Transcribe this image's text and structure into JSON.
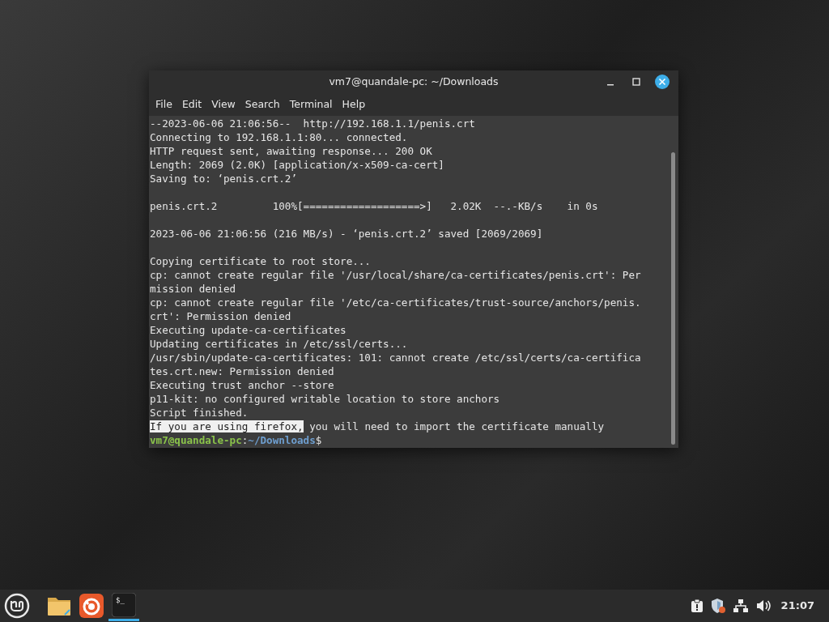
{
  "terminal": {
    "title": "vm7@quandale-pc: ~/Downloads",
    "menu": [
      "File",
      "Edit",
      "View",
      "Search",
      "Terminal",
      "Help"
    ],
    "lines": [
      {
        "kind": "text",
        "text": "--2023-06-06 21:06:56--  http://192.168.1.1/penis.crt"
      },
      {
        "kind": "text",
        "text": "Connecting to 192.168.1.1:80... connected."
      },
      {
        "kind": "text",
        "text": "HTTP request sent, awaiting response... 200 OK"
      },
      {
        "kind": "text",
        "text": "Length: 2069 (2.0K) [application/x-x509-ca-cert]"
      },
      {
        "kind": "text",
        "text": "Saving to: ‘penis.crt.2’"
      },
      {
        "kind": "blank"
      },
      {
        "kind": "text",
        "text": "penis.crt.2         100%[===================>]   2.02K  --.-KB/s    in 0s"
      },
      {
        "kind": "blank"
      },
      {
        "kind": "text",
        "text": "2023-06-06 21:06:56 (216 MB/s) - ‘penis.crt.2’ saved [2069/2069]"
      },
      {
        "kind": "blank"
      },
      {
        "kind": "text",
        "text": "Copying certificate to root store..."
      },
      {
        "kind": "text",
        "text": "cp: cannot create regular file '/usr/local/share/ca-certificates/penis.crt': Per"
      },
      {
        "kind": "text",
        "text": "mission denied"
      },
      {
        "kind": "text",
        "text": "cp: cannot create regular file '/etc/ca-certificates/trust-source/anchors/penis."
      },
      {
        "kind": "text",
        "text": "crt': Permission denied"
      },
      {
        "kind": "text",
        "text": "Executing update-ca-certificates"
      },
      {
        "kind": "text",
        "text": "Updating certificates in /etc/ssl/certs..."
      },
      {
        "kind": "text",
        "text": "/usr/sbin/update-ca-certificates: 101: cannot create /etc/ssl/certs/ca-certifica"
      },
      {
        "kind": "text",
        "text": "tes.crt.new: Permission denied"
      },
      {
        "kind": "text",
        "text": "Executing trust anchor --store"
      },
      {
        "kind": "text",
        "text": "p11-kit: no configured writable location to store anchors"
      },
      {
        "kind": "text",
        "text": "Script finished."
      },
      {
        "kind": "selection",
        "selected_text": "If you are using firefox,",
        "text": " you will need to import the certificate manually"
      },
      {
        "kind": "prompt",
        "user_host": "vm7@quandale-pc",
        "separator": ":",
        "path": "~/Downloads",
        "symbol": "$"
      }
    ]
  },
  "taskbar": {
    "apps": [
      {
        "kind": "folder",
        "active": false
      },
      {
        "kind": "browser",
        "active": false
      },
      {
        "kind": "terminal",
        "active": true,
        "glyph": "$_"
      }
    ],
    "clock": "21:07"
  }
}
